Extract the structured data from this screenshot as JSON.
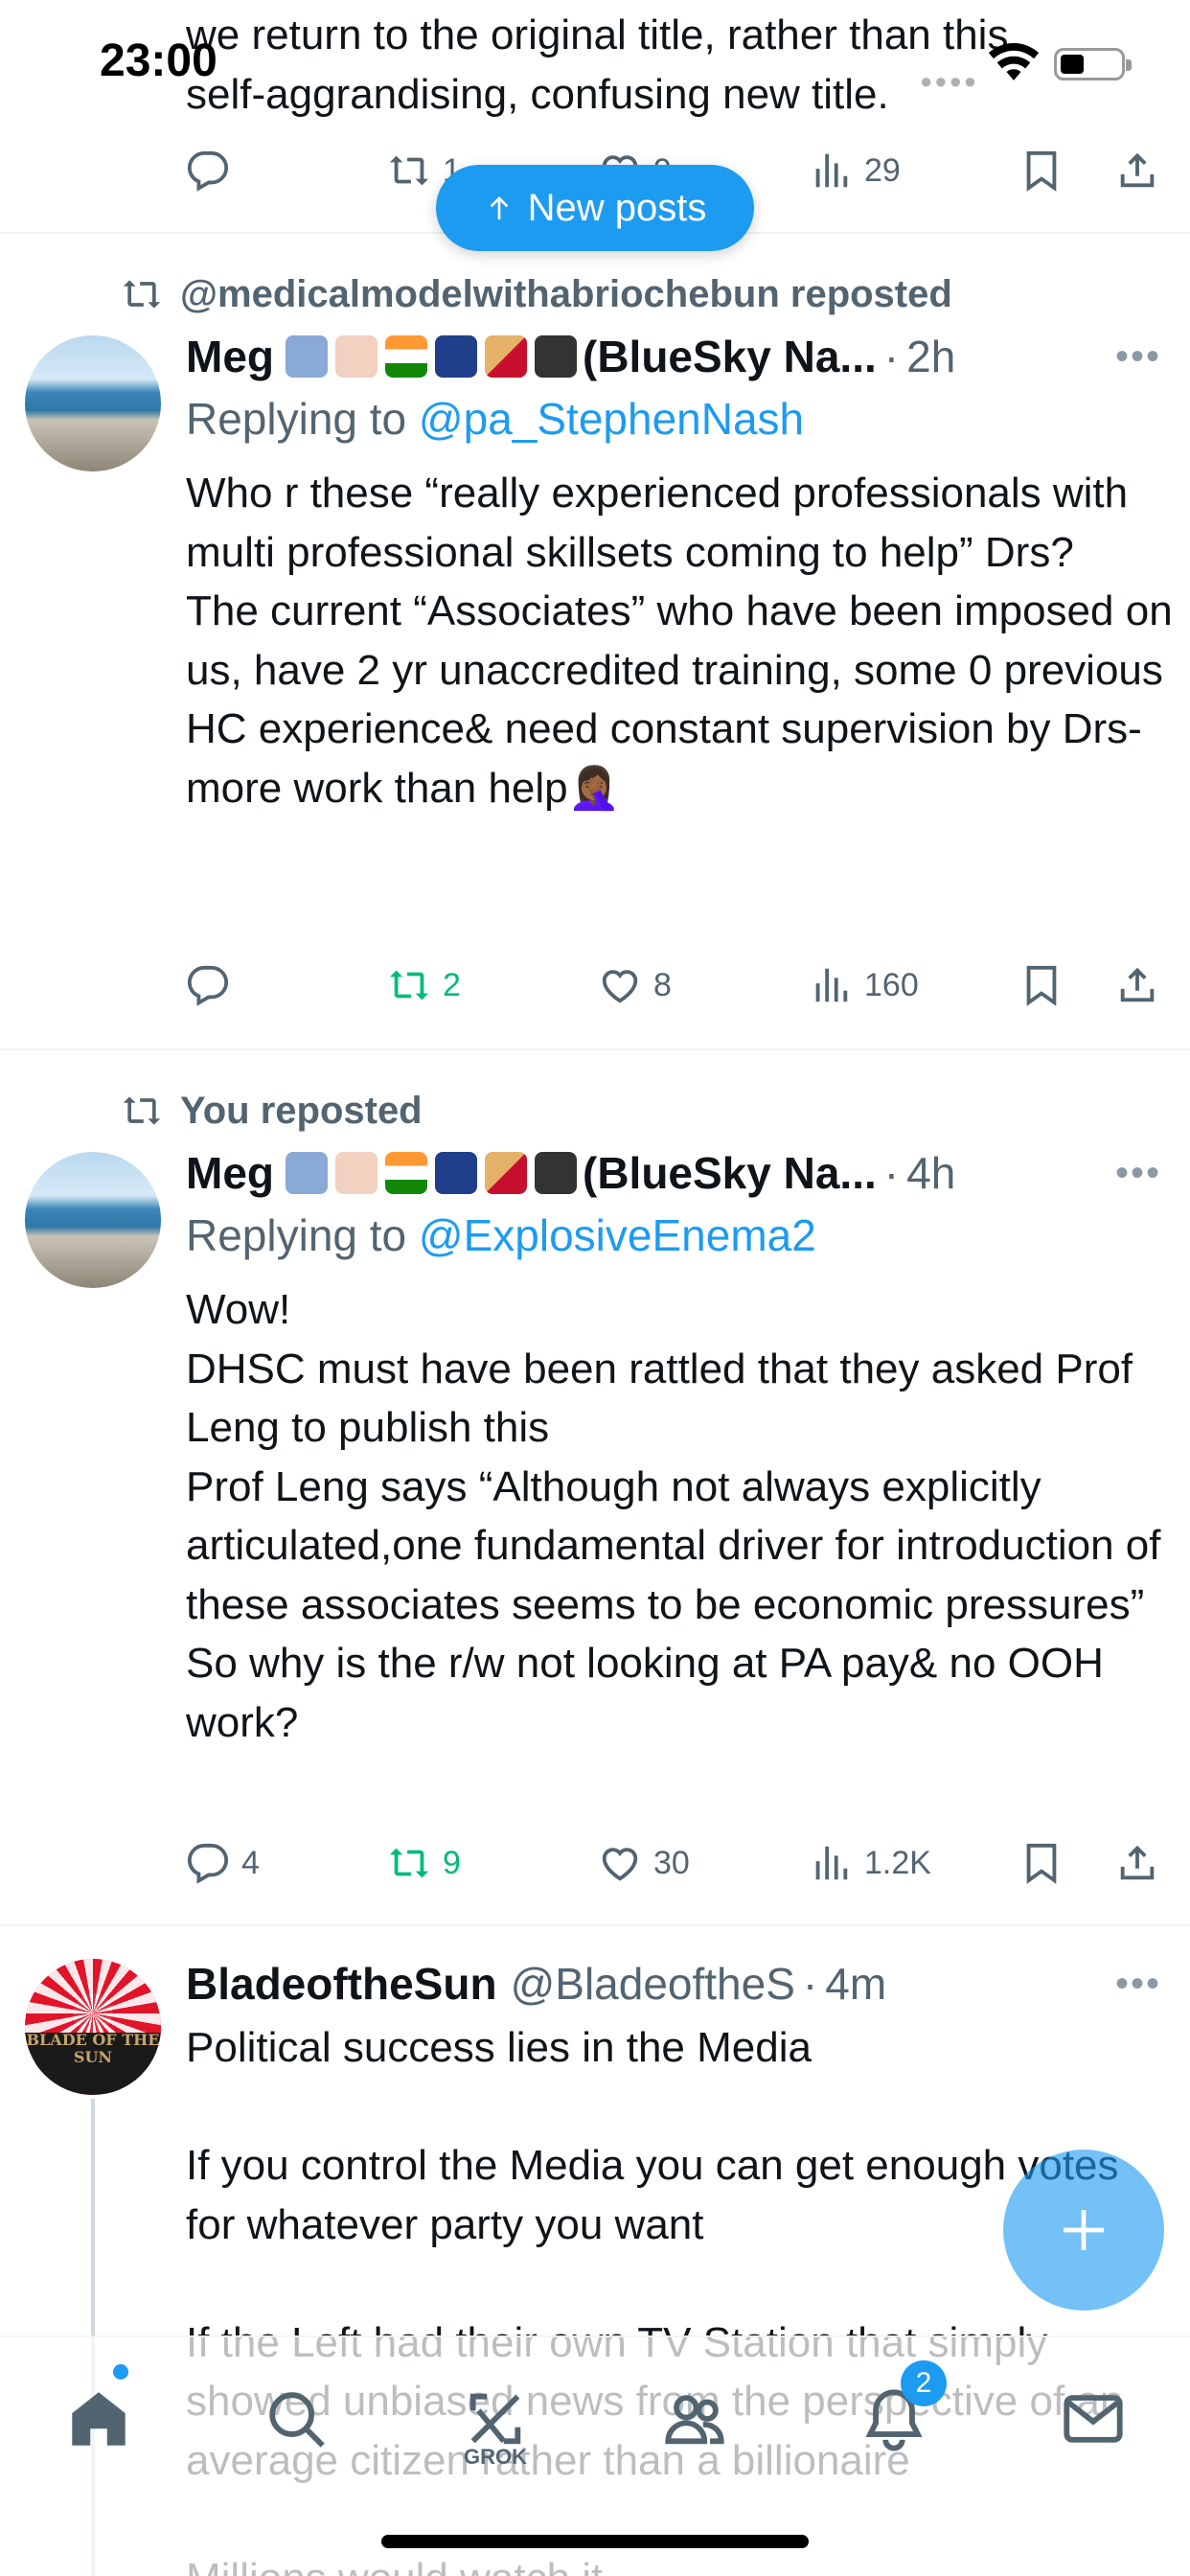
{
  "status_bar": {
    "time": "23:00"
  },
  "new_posts_label": "New posts",
  "previous_post": {
    "text": "we return to the original title, rather than this\nself-aggrandising, confusing  new title.",
    "reposts": "1",
    "likes": "9",
    "views": "29"
  },
  "posts": [
    {
      "repost_label": "@medicalmodelwithabriochebun reposted",
      "name": "Meg",
      "name_suffix": "(BlueSky Na...",
      "time": "2h",
      "replying_prefix": "Replying to",
      "replying_handle": "@pa_StephenNash",
      "body": "Who r these “really experienced professionals with multi professional skillsets coming to help” Drs?\nThe current “Associates” who have been imposed on us, have 2 yr unaccredited training, some 0 previous HC experience& need constant supervision by Drs- more work than help🤦🏾‍♀️",
      "replies": "",
      "reposts": "2",
      "likes": "8",
      "views": "160"
    },
    {
      "repost_label": "You reposted",
      "name": "Meg",
      "name_suffix": "(BlueSky Na...",
      "time": "4h",
      "replying_prefix": "Replying to",
      "replying_handle": "@ExplosiveEnema2",
      "body": "Wow!\nDHSC must have been rattled that they asked Prof Leng to publish this\nProf Leng says “Although not always explicitly articulated,one fundamental driver for introduction of these associates seems to be economic pressures”\nSo why is the r/w not looking at PA pay& no OOH work?",
      "replies": "4",
      "reposts": "9",
      "likes": "30",
      "views": "1.2K"
    },
    {
      "name": "BladeoftheSun",
      "handle": "@BladeoftheS",
      "time": "4m",
      "avatar_text": "BLADE OF THE SUN",
      "body": "Political success lies in the Media\n\nIf you control the Media you can get enough votes for whatever party you want\n\nIf the Left had their own TV Station that simply showed unbiased news from the perspective of an average citizen rather than a billionaire\n\nMillions would watch it"
    }
  ],
  "tabbar": {
    "grok_label": "GROK",
    "notification_count": "2"
  },
  "colors": {
    "accent": "#1d9bf0",
    "repost_green": "#00ba7c",
    "muted": "#536471",
    "text": "#0f1419"
  },
  "icons": [
    "reply-icon",
    "repost-icon",
    "like-icon",
    "views-icon",
    "bookmark-icon",
    "share-icon",
    "home-icon",
    "search-icon",
    "grok-icon",
    "people-icon",
    "bell-icon",
    "mail-icon",
    "plus-icon",
    "arrow-up-icon",
    "wifi-icon",
    "battery-icon"
  ]
}
